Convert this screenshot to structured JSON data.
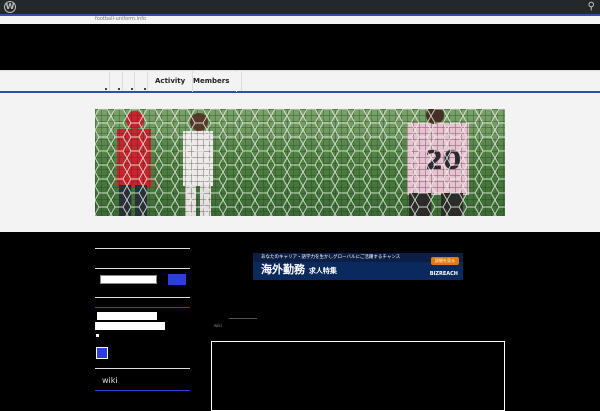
{
  "site": {
    "url": "football-uniform.info"
  },
  "nav": {
    "items": [
      {
        "label": "Activity"
      },
      {
        "label": "Members"
      }
    ]
  },
  "ad": {
    "top_text": "あなたのキャリア・語学力を生かしグローバルにご活躍するチャンス",
    "main_text": "海外勤務",
    "sub_text": "求人特集",
    "button_text": "詳細を見る",
    "brand": "BIZREACH"
  },
  "sidebar": {
    "wiki_label": "wiki"
  },
  "main": {
    "meta_text": "wiki"
  },
  "banner": {
    "player_number": "20"
  },
  "icons": {
    "wordpress": "wordpress-icon",
    "search": "search-icon"
  },
  "colors": {
    "accent": "#2f4fa8",
    "button": "#2b3fd9",
    "admin_bar": "#23282d"
  }
}
